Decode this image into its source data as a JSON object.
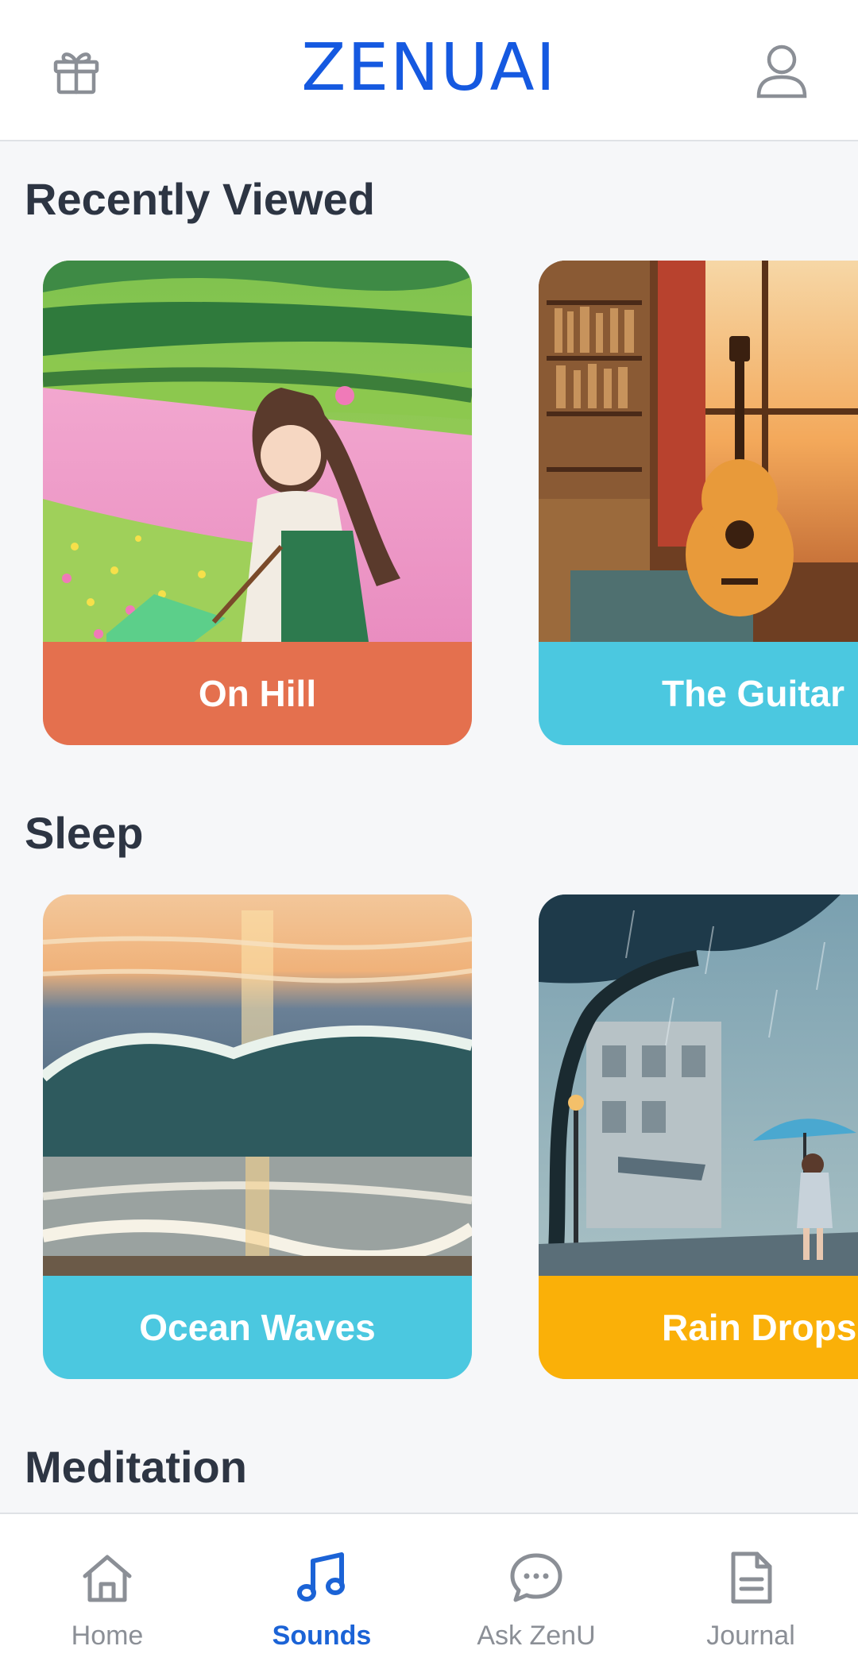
{
  "header": {
    "logo": "ZENUAI",
    "gift_icon": "gift-icon",
    "profile_icon": "user-icon"
  },
  "sections": {
    "recent": {
      "title": "Recently Viewed",
      "cards": [
        {
          "label": "On Hill",
          "color": "#e4704e"
        },
        {
          "label": "The Guitar",
          "color": "#4bc8e0"
        }
      ]
    },
    "sleep": {
      "title": "Sleep",
      "cards": [
        {
          "label": "Ocean Waves",
          "color": "#4bc8e0"
        },
        {
          "label": "Rain Drops",
          "color": "#fab008"
        }
      ]
    },
    "meditation": {
      "title": "Meditation"
    }
  },
  "nav": {
    "items": [
      {
        "label": "Home",
        "icon": "home-icon"
      },
      {
        "label": "Sounds",
        "icon": "music-note-icon",
        "active": true
      },
      {
        "label": "Ask ZenU",
        "icon": "chat-bubble-icon"
      },
      {
        "label": "Journal",
        "icon": "document-icon"
      }
    ]
  },
  "colors": {
    "brand": "#1559e0",
    "active_nav": "#1b63d6",
    "inactive_nav": "#8b8f96",
    "background": "#f6f7f9"
  }
}
